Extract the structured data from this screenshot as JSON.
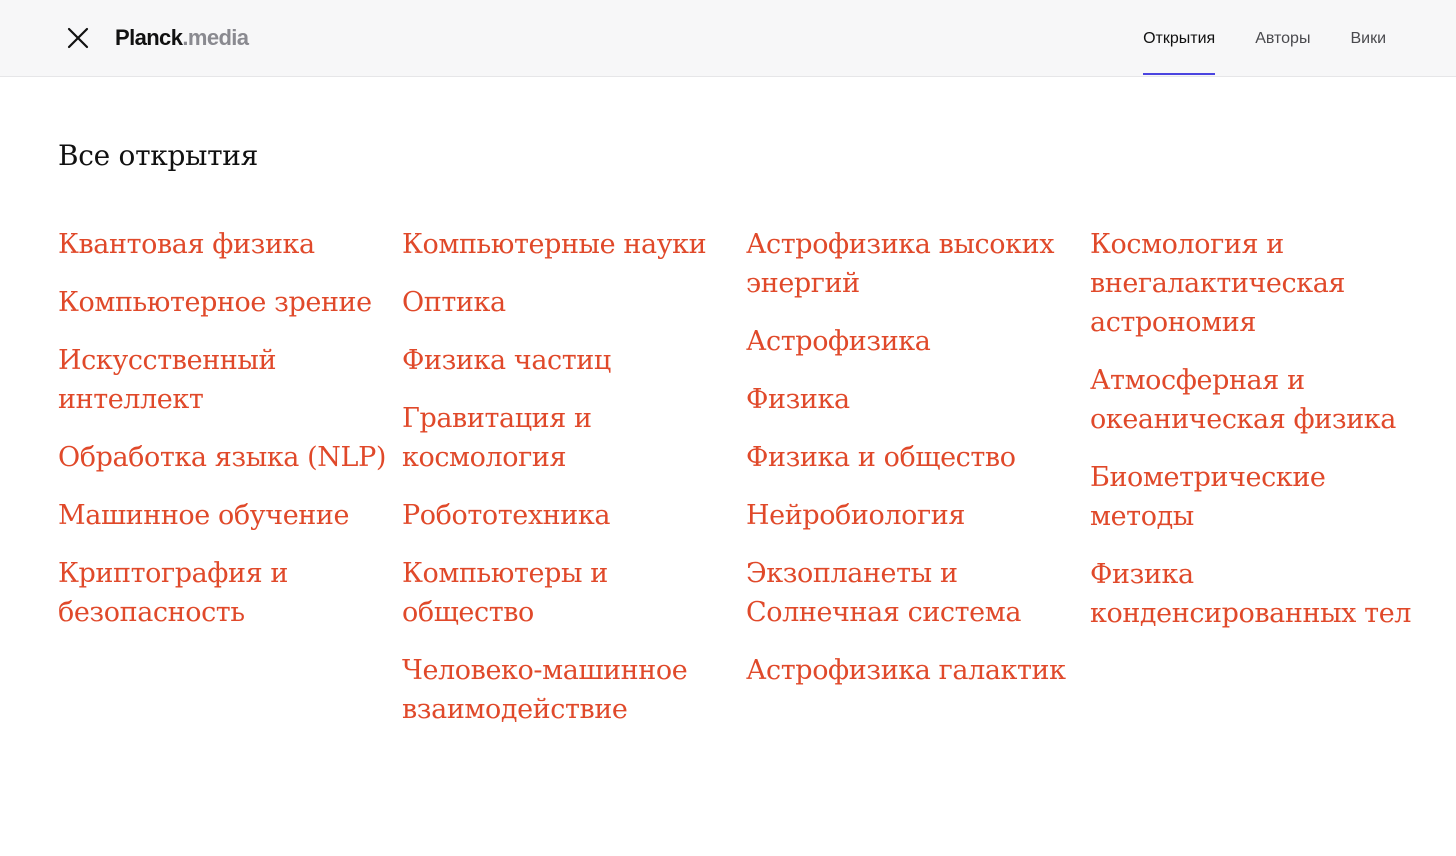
{
  "header": {
    "logo_main": "Planck",
    "logo_sub": ".media",
    "nav": [
      {
        "label": "Открытия",
        "active": true
      },
      {
        "label": "Авторы",
        "active": false
      },
      {
        "label": "Вики",
        "active": false
      }
    ]
  },
  "main": {
    "title": "Все открытия",
    "columns": [
      [
        "Квантовая физика",
        "Компьютерное зрение",
        "Искусственный интеллект",
        "Обработка языка (NLP)",
        "Машинное обучение",
        "Криптография и безопасность"
      ],
      [
        "Компьютерные науки",
        "Оптика",
        "Физика частиц",
        "Гравитация и космология",
        "Робототехника",
        "Компьютеры и общество",
        "Человеко-машинное взаимодействие"
      ],
      [
        "Астрофизика высоких энергий",
        "Астрофизика",
        "Физика",
        "Физика и общество",
        "Нейробиология",
        "Экзопланеты и Солнечная система",
        "Астрофизика галактик"
      ],
      [
        "Космология и внегалактическая астрономия",
        "Атмосферная и океаническая физика",
        "Биометрические методы",
        "Физика конденсированных тел"
      ]
    ]
  },
  "colors": {
    "accent_link": "#e0492a",
    "nav_underline": "#4b44e0",
    "header_bg": "#f7f7f8"
  },
  "icons": {
    "close": "close-icon"
  }
}
